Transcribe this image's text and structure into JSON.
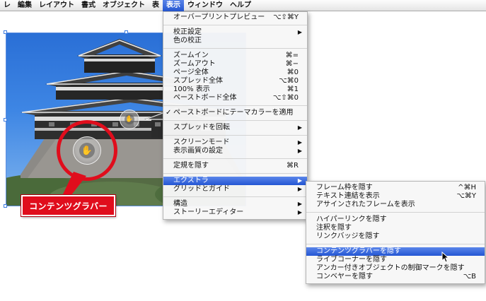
{
  "menubar": {
    "items": [
      "レ",
      "編集",
      "レイアウト",
      "書式",
      "オブジェクト",
      "表",
      "表示",
      "ウィンドウ",
      "ヘルプ"
    ],
    "active_index": 6
  },
  "view_menu": {
    "items": [
      {
        "label": "オーバープリントプレビュー",
        "shortcut": "⌥⇧⌘Y"
      },
      {
        "label": "校正設定",
        "submenu": true
      },
      {
        "label": "色の校正"
      },
      {
        "label": "ズームイン",
        "shortcut": "⌘="
      },
      {
        "label": "ズームアウト",
        "shortcut": "⌘−"
      },
      {
        "label": "ページ全体",
        "shortcut": "⌘0"
      },
      {
        "label": "スプレッド全体",
        "shortcut": "⌥⌘0"
      },
      {
        "label": "100% 表示",
        "shortcut": "⌘1"
      },
      {
        "label": "ペーストボード全体",
        "shortcut": "⌥⇧⌘0"
      },
      {
        "label": "ペーストボードにテーマカラーを適用",
        "checked": true
      },
      {
        "label": "スプレッドを回転",
        "submenu": true
      },
      {
        "label": "スクリーンモード",
        "submenu": true
      },
      {
        "label": "表示画質の設定",
        "submenu": true
      },
      {
        "label": "定規を隠す",
        "shortcut": "⌘R"
      },
      {
        "label": "エクストラ",
        "submenu": true,
        "highlighted": true
      },
      {
        "label": "グリッドとガイド",
        "submenu": true
      },
      {
        "label": "構造",
        "submenu": true
      },
      {
        "label": "ストーリーエディター",
        "submenu": true
      }
    ]
  },
  "extras_menu": {
    "items": [
      {
        "label": "フレーム枠を隠す",
        "shortcut": "^⌘H"
      },
      {
        "label": "テキスト連結を表示",
        "shortcut": "⌥⌘Y"
      },
      {
        "label": "アサインされたフレームを表示"
      },
      {
        "label": "ハイパーリンクを隠す"
      },
      {
        "label": "注釈を隠す"
      },
      {
        "label": "リンクバッジを隠す"
      },
      {
        "label": "コンテンツグラバーを隠す",
        "highlighted": true
      },
      {
        "label": "ライブコーナーを隠す"
      },
      {
        "label": "アンカー付きオブジェクトの制御マークを隠す"
      },
      {
        "label": "コンベヤーを隠す",
        "shortcut": "⌥B"
      }
    ]
  },
  "callout": {
    "label": "コンテンツグラバー",
    "color": "#e00d1c"
  },
  "icons": {
    "grabber": "hand-icon",
    "check": "checkmark-icon",
    "submenu": "triangle-right-icon",
    "cursor": "arrow-cursor-icon"
  },
  "colors": {
    "highlight": "#2e62d9",
    "callout_red": "#e00d1c",
    "frame_blue": "#3d7be0"
  }
}
